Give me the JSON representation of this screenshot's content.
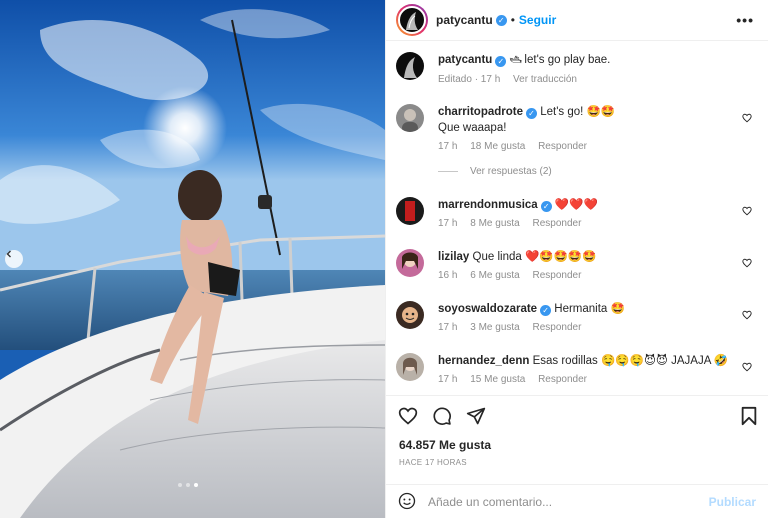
{
  "post": {
    "author": "patycantu",
    "follow_label": "Seguir",
    "separator": "•",
    "more_label": "•••"
  },
  "caption": {
    "author": "patycantu",
    "text_emoji": "🛥",
    "text": " let's go play bae.",
    "edited": "Editado · 17 h",
    "see_translation": "Ver traducción"
  },
  "comments": [
    {
      "user": "charritopadrote",
      "verified": true,
      "text": "Let's go! 🤩🤩",
      "text2": "Que waaapa!",
      "time": "17 h",
      "likes": "18 Me gusta",
      "reply": "Responder",
      "avatar_color": "#8a8a8a"
    },
    {
      "user": "marrendonmusica",
      "verified": true,
      "text": "❤️❤️❤️",
      "time": "17 h",
      "likes": "8 Me gusta",
      "reply": "Responder",
      "avatar_color": "#1a1a1a"
    },
    {
      "user": "lizilay",
      "verified": false,
      "text": "Que linda ❤️🤩🤩🤩🤩",
      "time": "16 h",
      "likes": "6 Me gusta",
      "reply": "Responder",
      "avatar_color": "#c46a9a"
    },
    {
      "user": "soyoswaldozarate",
      "verified": true,
      "text": "Hermanita 🤩",
      "time": "17 h",
      "likes": "3 Me gusta",
      "reply": "Responder",
      "avatar_color": "#3b2a22"
    },
    {
      "user": "hernandez_denn",
      "verified": false,
      "text": "Esas rodillas 🤤🤤🤤😈😈 JAJAJA 🤣",
      "time": "17 h",
      "likes": "15 Me gusta",
      "reply": "Responder",
      "avatar_color": "#b9b1a8"
    }
  ],
  "view_replies": "Ver respuestas (2)",
  "likes_count": "64.857 Me gusta",
  "time_ago": "HACE 17 HORAS",
  "comment_input": {
    "placeholder": "Añade un comentario...",
    "publish_label": "Publicar"
  },
  "carousel": {
    "current": 3,
    "total": 3
  },
  "colors": {
    "accent": "#0095f6",
    "verified": "#3897f0",
    "publish_disabled": "#b3dbff"
  },
  "icons": [
    "chevron-left-icon",
    "more-icon",
    "verified-icon",
    "heart-icon",
    "comment-icon",
    "share-icon",
    "bookmark-icon",
    "emoji-icon"
  ]
}
